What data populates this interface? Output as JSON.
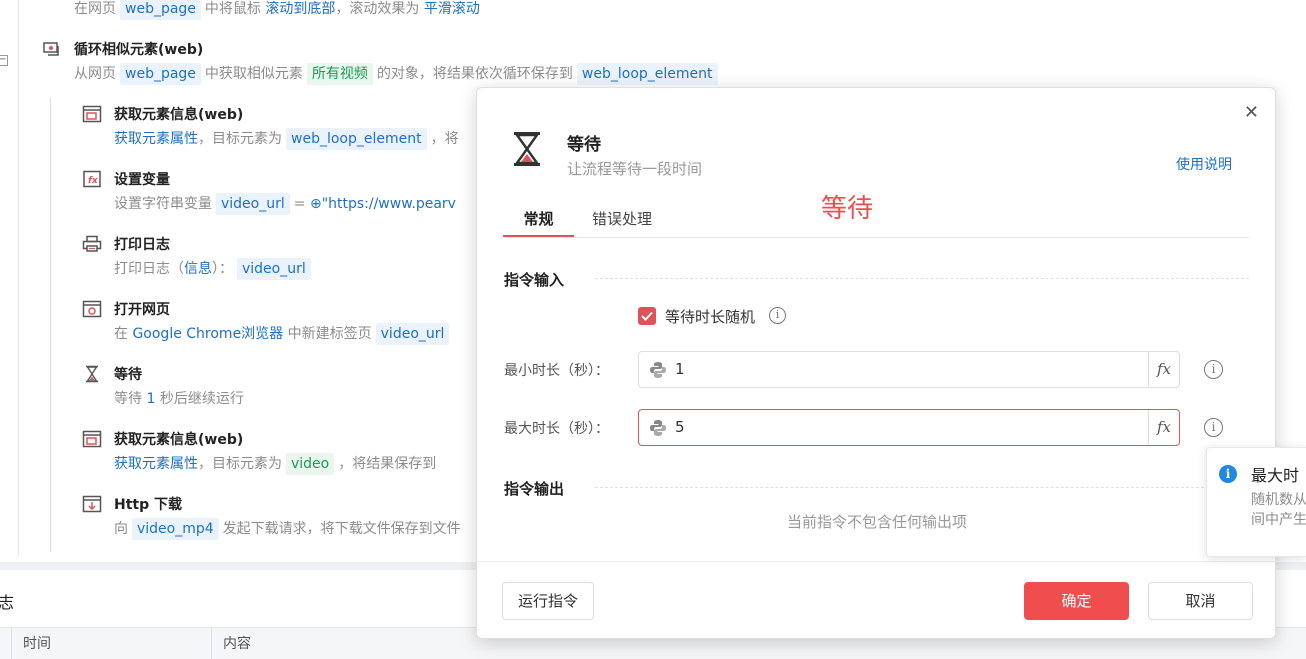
{
  "workflow": {
    "scroll_step": {
      "prefix": "在网页",
      "page": "web_page",
      "mid": "中将鼠标",
      "action": "滚动到底部",
      "sep": "，滚动效果为",
      "effect": "平滑滚动"
    },
    "loop": {
      "title": "循环相似元素(web)",
      "prefix": "从网页",
      "page": "web_page",
      "mid": "中获取相似元素",
      "element": "所有视频",
      "suffix": "的对象，将结果依次循环保存到",
      "var": "web_loop_element"
    },
    "get_info_1": {
      "title": "获取元素信息(web)",
      "action": "获取元素属性",
      "mid": "，目标元素为",
      "target": "web_loop_element",
      "trail": "，将"
    },
    "set_var": {
      "title": "设置变量",
      "prefix": "设置字符串变量",
      "var": "video_url",
      "eq": "=",
      "value": "\"https://www.pearv"
    },
    "print_log": {
      "title": "打印日志",
      "prefix": "打印日志（",
      "level": "信息",
      "suffix": "）：",
      "var": "video_url"
    },
    "open_page": {
      "title": "打开网页",
      "prefix": "在",
      "browser": "Google Chrome浏览器",
      "mid": "中新建标签页",
      "var": "video_url"
    },
    "wait": {
      "title": "等待",
      "prefix": "等待",
      "num": "1",
      "suffix": "秒后继续运行"
    },
    "get_info_2": {
      "title": "获取元素信息(web)",
      "action": "获取元素属性",
      "mid": "，目标元素为",
      "target": "video",
      "suffix": "，将结果保存到"
    },
    "http": {
      "title": "Http 下载",
      "prefix": "向",
      "var": "video_mp4",
      "suffix": "发起下载请求，将下载文件保存到文件"
    }
  },
  "log_panel": {
    "title": "志",
    "col_time": "时间",
    "col_content": "内容"
  },
  "dialog": {
    "title": "等待",
    "subtitle": "让流程等待一段时间",
    "help_link": "使用说明",
    "overlay_text": "等待",
    "tabs": [
      {
        "label": "常规",
        "active": true
      },
      {
        "label": "错误处理",
        "active": false
      }
    ],
    "input_section": "指令输入",
    "random_checkbox": {
      "label": "等待时长随机",
      "checked": true
    },
    "min_duration": {
      "label": "最小时长（秒）：",
      "value": "1"
    },
    "max_duration": {
      "label": "最大时长（秒）：",
      "value": "5"
    },
    "fx_label": "fx",
    "output_section": "指令输出",
    "output_empty": "当前指令不包含任何输出项",
    "run_button": "运行指令",
    "confirm_button": "确定",
    "cancel_button": "取消",
    "close_symbol": "✕"
  },
  "tooltip": {
    "title": "最大时",
    "line1": "随机数从",
    "line2": "间中产生"
  },
  "colors": {
    "accent_red": "#f04e4e",
    "link_blue": "#1f6fc5",
    "token_bg": "#eaf3fc",
    "green": "#1e9a55"
  }
}
